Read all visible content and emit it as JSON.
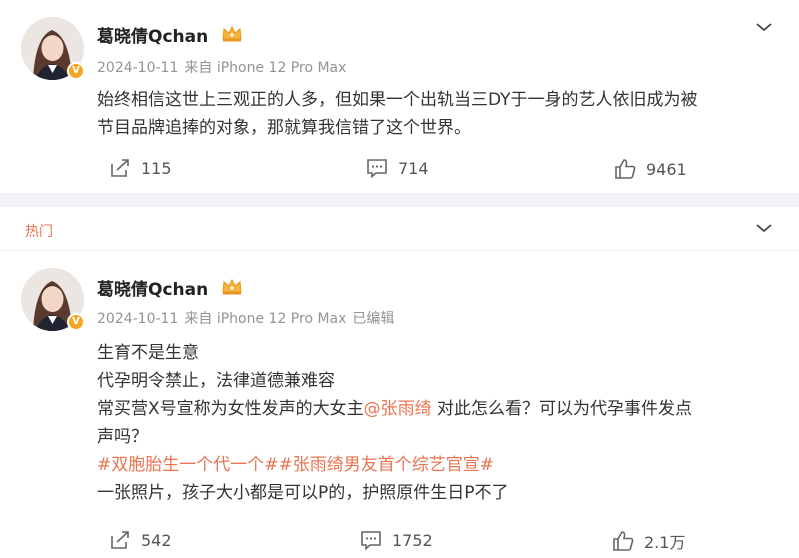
{
  "post1": {
    "author": "葛晓倩Qchan",
    "date": "2024-10-11",
    "source": "来自 iPhone 12 Pro Max",
    "lines": [
      "始终相信这世上三观正的人多，但如果一个出轨当三DY于一身的艺人依旧成为被",
      "节目品牌追捧的对象，那就算我信错了这个世界。"
    ],
    "repost_count": "115",
    "comment_count": "714",
    "like_count": "9461"
  },
  "section": {
    "label": "热门"
  },
  "post2": {
    "author": "葛晓倩Qchan",
    "date": "2024-10-11",
    "source": "来自 iPhone 12 Pro Max",
    "edited": "已编辑",
    "line1": "生育不是生意",
    "line2": "代孕明令禁止，法律道德兼难容",
    "line3_pre": "常买营X号宣称为女性发声的大女主",
    "mention": "@张雨绮",
    "line3_post": " 对此怎么看？可以为代孕事件发点",
    "line4": "声吗？",
    "topic1": "#双胞胎生一个代一个#",
    "topic2": "#张雨绮男友首个综艺官宣#",
    "line6": "一张照片，孩子大小都是可以P的，护照原件生日P不了",
    "repost_count": "542",
    "comment_count": "1752",
    "like_count": "2.1万"
  },
  "colors": {
    "accent": "#eb7350",
    "muted": "#939393",
    "verified": "#f5a623"
  },
  "icons": [
    "avatar",
    "verified-badge-icon",
    "crown-icon",
    "chevron-down-icon",
    "repost-icon",
    "comment-icon",
    "like-icon"
  ]
}
